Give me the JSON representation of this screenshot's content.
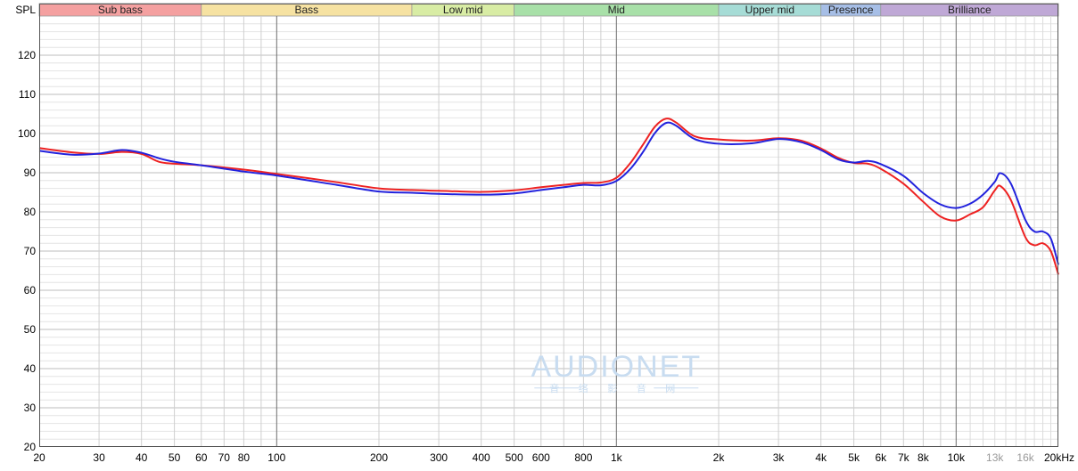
{
  "chart_data": {
    "type": "line",
    "ylabel": "SPL",
    "x_scale": "log",
    "xlim": [
      20,
      20000
    ],
    "ylim": [
      20,
      130
    ],
    "y_ticks": [
      20,
      30,
      40,
      50,
      60,
      70,
      80,
      90,
      100,
      110,
      120
    ],
    "x_ticks": [
      {
        "value": 20,
        "label": "20"
      },
      {
        "value": 30,
        "label": "30"
      },
      {
        "value": 40,
        "label": "40"
      },
      {
        "value": 50,
        "label": "50"
      },
      {
        "value": 60,
        "label": "60"
      },
      {
        "value": 70,
        "label": "70"
      },
      {
        "value": 80,
        "label": "80"
      },
      {
        "value": 100,
        "label": "100"
      },
      {
        "value": 200,
        "label": "200"
      },
      {
        "value": 300,
        "label": "300"
      },
      {
        "value": 400,
        "label": "400"
      },
      {
        "value": 500,
        "label": "500"
      },
      {
        "value": 600,
        "label": "600"
      },
      {
        "value": 800,
        "label": "800"
      },
      {
        "value": 1000,
        "label": "1k"
      },
      {
        "value": 2000,
        "label": "2k"
      },
      {
        "value": 3000,
        "label": "3k"
      },
      {
        "value": 4000,
        "label": "4k"
      },
      {
        "value": 5000,
        "label": "5k"
      },
      {
        "value": 6000,
        "label": "6k"
      },
      {
        "value": 7000,
        "label": "7k"
      },
      {
        "value": 8000,
        "label": "8k"
      },
      {
        "value": 10000,
        "label": "10k"
      },
      {
        "value": 13000,
        "label": "13k",
        "dim": true
      },
      {
        "value": 16000,
        "label": "16k",
        "dim": true
      },
      {
        "value": 20000,
        "label": "20kHz"
      }
    ],
    "grid": true,
    "bands": [
      {
        "label": "Sub bass",
        "from": 20,
        "to": 60,
        "color": "#f4a0a0"
      },
      {
        "label": "Bass",
        "from": 60,
        "to": 250,
        "color": "#f6e2a2"
      },
      {
        "label": "Low mid",
        "from": 250,
        "to": 500,
        "color": "#d8eca4"
      },
      {
        "label": "Mid",
        "from": 500,
        "to": 2000,
        "color": "#a8e0a8"
      },
      {
        "label": "Upper mid",
        "from": 2000,
        "to": 4000,
        "color": "#a6dcd6"
      },
      {
        "label": "Presence",
        "from": 4000,
        "to": 6000,
        "color": "#a6bee6"
      },
      {
        "label": "Brilliance",
        "from": 6000,
        "to": 20000,
        "color": "#bfa8d6"
      }
    ],
    "watermark": {
      "main": "AUDIONET",
      "sub": "音 络 影 音 网"
    },
    "series": [
      {
        "color": "#ee2222",
        "points": [
          [
            20,
            96.3
          ],
          [
            25,
            95.2
          ],
          [
            30,
            94.8
          ],
          [
            35,
            95.3
          ],
          [
            40,
            94.8
          ],
          [
            45,
            92.8
          ],
          [
            50,
            92.3
          ],
          [
            60,
            91.9
          ],
          [
            80,
            90.8
          ],
          [
            100,
            89.7
          ],
          [
            150,
            87.6
          ],
          [
            200,
            86.0
          ],
          [
            250,
            85.6
          ],
          [
            300,
            85.4
          ],
          [
            400,
            85.1
          ],
          [
            500,
            85.5
          ],
          [
            600,
            86.3
          ],
          [
            700,
            86.9
          ],
          [
            800,
            87.4
          ],
          [
            900,
            87.5
          ],
          [
            1000,
            88.7
          ],
          [
            1100,
            92.5
          ],
          [
            1200,
            97.3
          ],
          [
            1300,
            101.8
          ],
          [
            1400,
            103.8
          ],
          [
            1500,
            102.8
          ],
          [
            1700,
            99.3
          ],
          [
            2000,
            98.5
          ],
          [
            2500,
            98.2
          ],
          [
            3000,
            98.8
          ],
          [
            3500,
            98.2
          ],
          [
            4000,
            96.2
          ],
          [
            4500,
            93.8
          ],
          [
            5000,
            92.5
          ],
          [
            5500,
            92.3
          ],
          [
            6000,
            91.0
          ],
          [
            7000,
            87.2
          ],
          [
            8000,
            82.6
          ],
          [
            9000,
            78.8
          ],
          [
            10000,
            77.8
          ],
          [
            11000,
            79.4
          ],
          [
            12000,
            81.2
          ],
          [
            13000,
            85.5
          ],
          [
            13500,
            86.6
          ],
          [
            14500,
            83.0
          ],
          [
            16000,
            73.5
          ],
          [
            17000,
            71.5
          ],
          [
            18000,
            72.0
          ],
          [
            19000,
            70.0
          ],
          [
            20000,
            64.0
          ]
        ]
      },
      {
        "color": "#2222dd",
        "points": [
          [
            20,
            95.6
          ],
          [
            25,
            94.6
          ],
          [
            30,
            94.9
          ],
          [
            35,
            95.8
          ],
          [
            40,
            95.1
          ],
          [
            45,
            93.7
          ],
          [
            50,
            92.8
          ],
          [
            60,
            91.9
          ],
          [
            80,
            90.3
          ],
          [
            100,
            89.3
          ],
          [
            150,
            86.9
          ],
          [
            200,
            85.2
          ],
          [
            250,
            84.9
          ],
          [
            300,
            84.6
          ],
          [
            400,
            84.4
          ],
          [
            500,
            84.7
          ],
          [
            600,
            85.6
          ],
          [
            700,
            86.3
          ],
          [
            800,
            86.9
          ],
          [
            900,
            86.8
          ],
          [
            1000,
            87.9
          ],
          [
            1100,
            91.0
          ],
          [
            1200,
            95.4
          ],
          [
            1300,
            100.2
          ],
          [
            1400,
            102.7
          ],
          [
            1500,
            102.0
          ],
          [
            1700,
            98.6
          ],
          [
            2000,
            97.4
          ],
          [
            2500,
            97.5
          ],
          [
            3000,
            98.6
          ],
          [
            3500,
            97.8
          ],
          [
            4000,
            95.8
          ],
          [
            4500,
            93.4
          ],
          [
            5000,
            92.6
          ],
          [
            5500,
            93.0
          ],
          [
            6000,
            92.2
          ],
          [
            7000,
            89.2
          ],
          [
            8000,
            84.8
          ],
          [
            9000,
            81.9
          ],
          [
            10000,
            81.0
          ],
          [
            11000,
            82.1
          ],
          [
            12000,
            84.4
          ],
          [
            13000,
            87.7
          ],
          [
            13500,
            89.9
          ],
          [
            14500,
            87.2
          ],
          [
            16000,
            77.9
          ],
          [
            17000,
            75.0
          ],
          [
            18000,
            75.0
          ],
          [
            19000,
            73.2
          ],
          [
            20000,
            66.5
          ]
        ]
      }
    ]
  }
}
